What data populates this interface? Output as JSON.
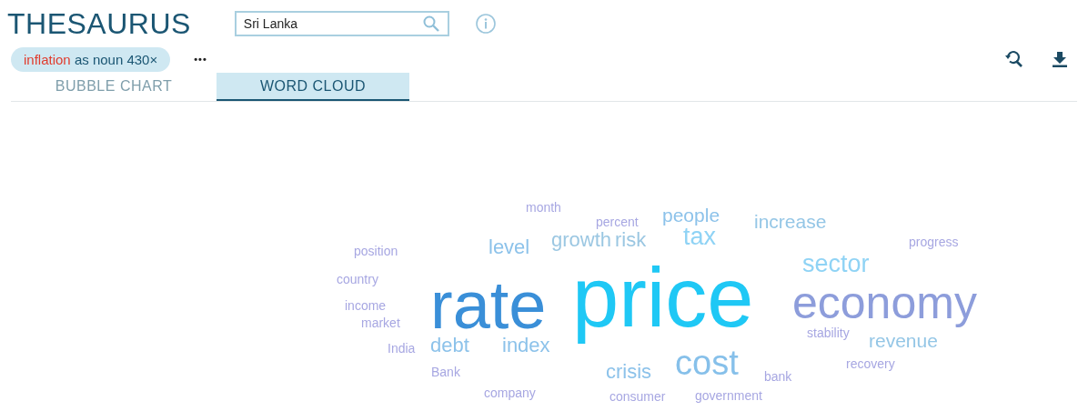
{
  "title": "THESAURUS",
  "search": {
    "value": "Sri Lanka"
  },
  "query_chip": {
    "word": "inflation",
    "detail": "as noun 430×"
  },
  "more_button": "•••",
  "tabs": [
    {
      "label": "BUBBLE CHART",
      "selected": false
    },
    {
      "label": "WORD CLOUD",
      "selected": true
    }
  ],
  "word_cloud": [
    {
      "text": "month",
      "color": "#a7a7e2"
    },
    {
      "text": "percent",
      "color": "#a7a7e2"
    },
    {
      "text": "people",
      "color": "#8cc2ea"
    },
    {
      "text": "increase",
      "color": "#94c6e6"
    },
    {
      "text": "position",
      "color": "#a7a7e2"
    },
    {
      "text": "level",
      "color": "#8cc2ea"
    },
    {
      "text": "growth",
      "color": "#9bc7e2"
    },
    {
      "text": "risk",
      "color": "#9bc7e2"
    },
    {
      "text": "tax",
      "color": "#8fd3f5"
    },
    {
      "text": "progress",
      "color": "#a7a7e2"
    },
    {
      "text": "sector",
      "color": "#8fd3f5"
    },
    {
      "text": "country",
      "color": "#a7a7e2"
    },
    {
      "text": "income",
      "color": "#a7a7e2"
    },
    {
      "text": "market",
      "color": "#a7a7e2"
    },
    {
      "text": "rate",
      "color": "#3a8fd8"
    },
    {
      "text": "price",
      "color": "#1fc8f5"
    },
    {
      "text": "economy",
      "color": "#8d9ddb"
    },
    {
      "text": "India",
      "color": "#a7a7e2"
    },
    {
      "text": "debt",
      "color": "#8cc2ea"
    },
    {
      "text": "index",
      "color": "#8cc2ea"
    },
    {
      "text": "cost",
      "color": "#86c0ea"
    },
    {
      "text": "stability",
      "color": "#a7a7e2"
    },
    {
      "text": "revenue",
      "color": "#94c6e6"
    },
    {
      "text": "Bank",
      "color": "#a7a7e2"
    },
    {
      "text": "crisis",
      "color": "#8cc2ea"
    },
    {
      "text": "bank",
      "color": "#a7a7e2"
    },
    {
      "text": "recovery",
      "color": "#a7a7e2"
    },
    {
      "text": "company",
      "color": "#a7a7e2"
    },
    {
      "text": "consumer",
      "color": "#a7a7e2"
    },
    {
      "text": "government",
      "color": "#a7a7e2"
    }
  ]
}
